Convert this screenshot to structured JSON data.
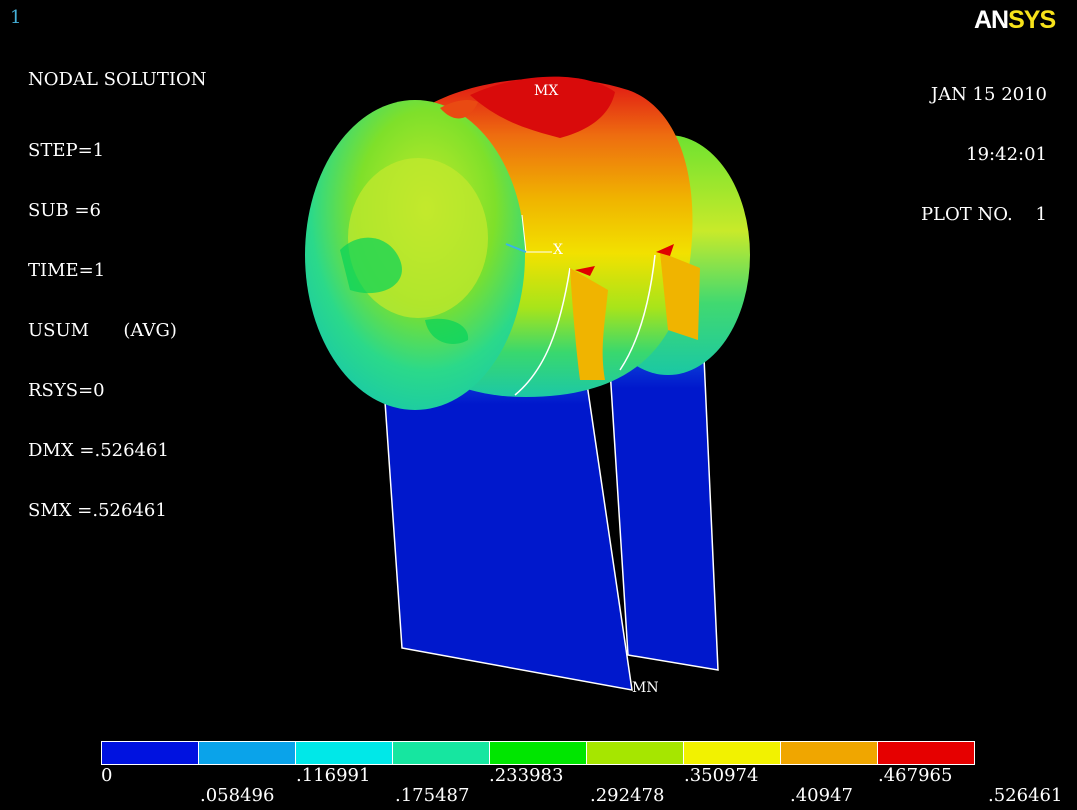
{
  "window_number": "1",
  "header": {
    "title": "NODAL SOLUTION",
    "lines": [
      "STEP=1",
      "SUB =6",
      "TIME=1",
      "USUM      (AVG)",
      "RSYS=0",
      "DMX =.526461",
      "SMX =.526461"
    ]
  },
  "stamp": {
    "date": "JAN 15 2010",
    "time": "19:42:01",
    "plot": "PLOT NO.    1"
  },
  "logo": {
    "part1": "AN",
    "part2": "SYS"
  },
  "markers": {
    "max": "MX",
    "min": "MN",
    "axis": "X"
  },
  "legend": {
    "colors": [
      "#0012e0",
      "#0aa3ea",
      "#00e8e8",
      "#16e6a0",
      "#00e600",
      "#a6e600",
      "#f2f200",
      "#f0a600",
      "#e60000"
    ],
    "labels_top": [
      "0",
      ".116991",
      ".233983",
      ".350974",
      ".467965"
    ],
    "labels_bottom": [
      ".058496",
      ".175487",
      ".292478",
      ".40947",
      ".526461"
    ]
  }
}
